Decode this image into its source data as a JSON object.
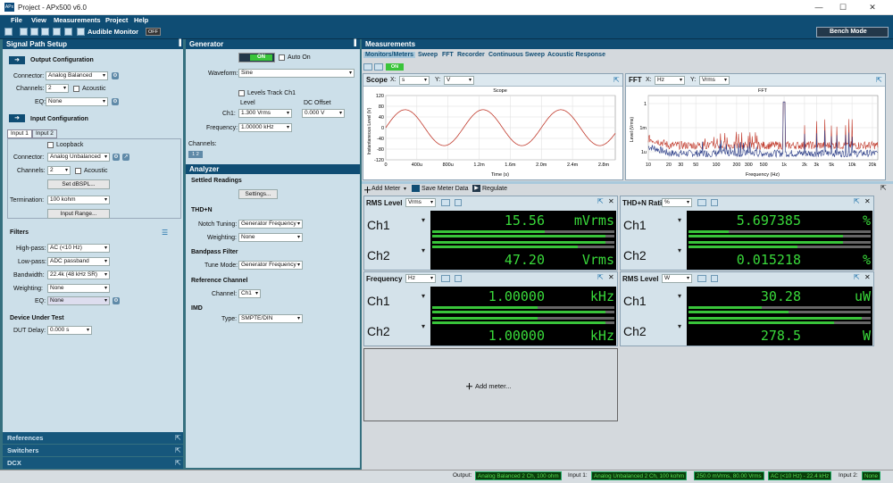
{
  "window": {
    "title": "Project - APx500 v6.0",
    "icon": "APx",
    "minimize": "—",
    "maximize": "☐",
    "close": "✕"
  },
  "menu": [
    "File",
    "View",
    "Measurements",
    "Project",
    "Help"
  ],
  "toolbar": {
    "audible_label": "Audible Monitor",
    "audible_state": "OFF",
    "bench_mode": "Bench Mode"
  },
  "signal_path": {
    "title": "Signal Path Setup",
    "output_config": {
      "title": "Output Configuration",
      "connector_label": "Connector:",
      "connector": "Analog Balanced",
      "channels_label": "Channels:",
      "channels": "2",
      "acoustic": "Acoustic",
      "eq_label": "EQ:",
      "eq": "None"
    },
    "input_config": {
      "title": "Input Configuration",
      "tabs": [
        "Input 1",
        "Input 2"
      ],
      "loopback": "Loopback",
      "connector_label": "Connector:",
      "connector": "Analog Unbalanced",
      "channels_label": "Channels:",
      "channels": "2",
      "acoustic": "Acoustic",
      "set_dbspl": "Set dBSPL...",
      "termination_label": "Termination:",
      "termination": "100 kohm",
      "input_range": "Input Range..."
    },
    "filters": {
      "title": "Filters",
      "highpass_label": "High-pass:",
      "highpass": "AC (<10 Hz)",
      "lowpass_label": "Low-pass:",
      "lowpass": "ADC passband",
      "bandwidth_label": "Bandwidth:",
      "bandwidth": "22.4k (48 kHz SR)",
      "weighting_label": "Weighting:",
      "weighting": "None",
      "eq_label": "EQ:",
      "eq": "None"
    },
    "dut": {
      "title": "Device Under Test",
      "delay_label": "DUT Delay:",
      "delay": "0.000 s"
    },
    "bottom": [
      "References",
      "Switchers",
      "DCX"
    ]
  },
  "generator": {
    "title": "Generator",
    "on": "ON",
    "auto_on": "Auto On",
    "waveform_label": "Waveform:",
    "waveform": "Sine",
    "levels_track": "Levels Track Ch1",
    "level_header": "Level",
    "dc_offset_header": "DC Offset",
    "ch1_label": "Ch1:",
    "level": "1.300 Vrms",
    "dc_offset": "0.000 V",
    "frequency_label": "Frequency:",
    "frequency": "1.00000 kHz",
    "channels_label": "Channels:",
    "channels_badge": "1 2"
  },
  "analyzer": {
    "title": "Analyzer",
    "settled_title": "Settled Readings",
    "settings": "Settings...",
    "thdn_title": "THD+N",
    "notch_label": "Notch Tuning:",
    "notch": "Generator Frequency",
    "weighting_label": "Weighting:",
    "weighting": "None",
    "bandpass_title": "Bandpass Filter",
    "tune_label": "Tune Mode:",
    "tune": "Generator Frequency",
    "ref_title": "Reference Channel",
    "channel_label": "Channel:",
    "channel": "Ch1",
    "imd_title": "IMD",
    "type_label": "Type:",
    "type": "SMPTE/DIN"
  },
  "measurements": {
    "title": "Measurements",
    "tabs": [
      "Monitors/Meters",
      "Sweep",
      "FFT",
      "Recorder",
      "Continuous Sweep",
      "Acoustic Response"
    ],
    "on": "ON",
    "add_meter": "Add Meter",
    "save_meter": "Save Meter Data",
    "regulate": "Regulate",
    "add_meter_placeholder": "Add meter..."
  },
  "scope": {
    "label": "Scope",
    "x_label": "X:",
    "x_unit": "s",
    "y_label": "Y:",
    "y_unit": "V"
  },
  "fft": {
    "label": "FFT",
    "x_label": "X:",
    "x_unit": "Hz",
    "y_label": "Y:",
    "y_unit": "Vrms"
  },
  "meters": {
    "rms": {
      "title": "RMS Level",
      "unit": "Vrms",
      "ch1": "Ch1",
      "ch2": "Ch2",
      "v1": "15.56",
      "u1": "mVrms",
      "v2": "47.20",
      "u2": "Vrms"
    },
    "thdn": {
      "title": "THD+N Ratio",
      "unit": "%",
      "ch1": "Ch1",
      "ch2": "Ch2",
      "v1": "5.697385",
      "u1": "%",
      "v2": "0.015218",
      "u2": "%"
    },
    "freq": {
      "title": "Frequency",
      "unit": "Hz",
      "ch1": "Ch1",
      "ch2": "Ch2",
      "v1": "1.00000",
      "u1": "kHz",
      "v2": "1.00000",
      "u2": "kHz"
    },
    "rmsw": {
      "title": "RMS Level",
      "unit": "W",
      "ch1": "Ch1",
      "ch2": "Ch2",
      "v1": "30.28",
      "u1": "uW",
      "v2": "278.5",
      "u2": "W"
    }
  },
  "status": {
    "output_label": "Output:",
    "output": "Analog Balanced 2 Ch, 100 ohm",
    "input1_label": "Input 1:",
    "input1": "Analog Unbalanced 2 Ch, 100 kohm",
    "input1_level": "250.0 mVrms, 80.00 Vrms",
    "input1_filter": "AC (<10 Hz) - 22.4 kHz",
    "input2_label": "Input 2:",
    "input2": "None"
  },
  "chart_data": [
    {
      "type": "line",
      "title": "Scope",
      "xlabel": "Time (s)",
      "ylabel": "Instantaneous Level (V)",
      "x_ticks": [
        "0",
        "400u",
        "800u",
        "1.2m",
        "1.6m",
        "2.0m",
        "2.4m",
        "2.8m"
      ],
      "y_ticks": [
        "120",
        "80",
        "40",
        "0",
        "-40",
        "-80",
        "-120"
      ],
      "xlim": [
        0,
        0.00295
      ],
      "ylim": [
        -120,
        120
      ],
      "series": [
        {
          "color": "#c0392b",
          "frequency_hz": 1000,
          "amplitude": 67
        }
      ]
    },
    {
      "type": "line",
      "title": "FFT",
      "xlabel": "Frequency (Hz)",
      "ylabel": "Level (Vrms)",
      "x_ticks": [
        "10",
        "20",
        "30",
        "50",
        "100",
        "200",
        "300",
        "500",
        "1k",
        "2k",
        "3k",
        "5k",
        "10k",
        "20k"
      ],
      "y_ticks": [
        "1",
        "1m",
        "1u"
      ],
      "xlim": [
        10,
        24000
      ],
      "ylim_decades": [
        -7,
        1
      ],
      "log_x": true,
      "log_y": true,
      "series": [
        {
          "color": "#c0392b"
        },
        {
          "color": "#2c3e88"
        }
      ]
    }
  ]
}
